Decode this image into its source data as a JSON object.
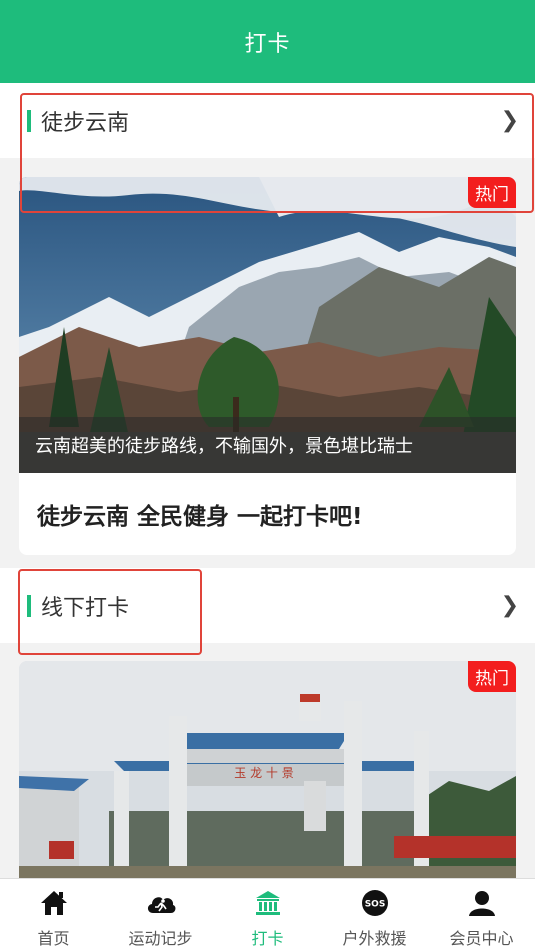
{
  "header": {
    "title": "打卡"
  },
  "sections": [
    {
      "title": "徒步云南",
      "chevron": "❯",
      "card": {
        "badge": "热门",
        "caption": "云南超美的徒步路线，不输国外，景色堪比瑞士",
        "title": "徒步云南 全民健身 一起打卡吧!"
      }
    },
    {
      "title": "线下打卡",
      "chevron": "❯",
      "card": {
        "badge": "热门",
        "gate_text": "玉 龙 十 景"
      }
    }
  ],
  "tabbar": {
    "items": [
      {
        "label": "首页",
        "icon": "home-icon"
      },
      {
        "label": "运动记步",
        "icon": "running-cloud-icon"
      },
      {
        "label": "打卡",
        "icon": "landmark-icon",
        "active": true
      },
      {
        "label": "户外救援",
        "icon": "sos-icon"
      },
      {
        "label": "会员中心",
        "icon": "user-icon"
      }
    ]
  },
  "colors": {
    "brand": "#1ebc7c",
    "badge": "#f31e1e",
    "highlight": "#e0443a"
  }
}
